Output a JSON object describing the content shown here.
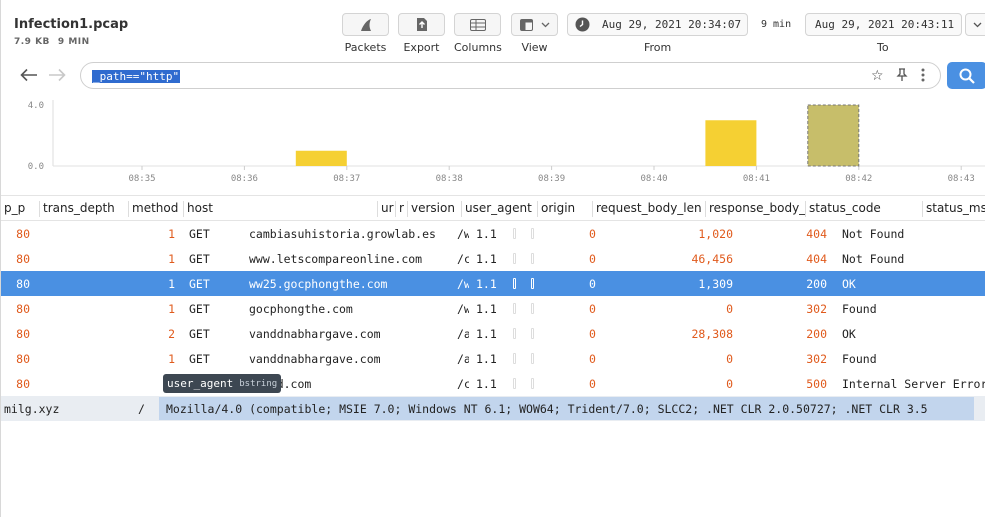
{
  "file": {
    "name": "Infection1.pcap",
    "size": "7.9 KB",
    "duration": "9 MIN"
  },
  "toolbar": {
    "packets": "Packets",
    "export": "Export",
    "columns": "Columns",
    "view": "View",
    "from_value": "Aug 29, 2021 20:34:07",
    "from_label": "From",
    "span": "9 min",
    "to_value": "Aug 29, 2021 20:43:11",
    "to_label": "To"
  },
  "search": {
    "query": "_path==\"http\""
  },
  "histogram": {
    "y_ticks": [
      "4.0",
      "0.0"
    ],
    "x_ticks": [
      "08:35",
      "08:36",
      "08:37",
      "08:38",
      "08:39",
      "08:40",
      "08:41",
      "08:42",
      "08:43"
    ],
    "bars": [
      {
        "minute": "08:37",
        "count": 1
      },
      {
        "minute": "08:41",
        "count": 3
      },
      {
        "minute": "08:42",
        "count": 4,
        "hover": true
      }
    ],
    "bar_color": "#f5d033",
    "hover_color": "#c7be6a"
  },
  "table": {
    "columns": [
      "p_p",
      "trans_depth",
      "method",
      "host",
      "ur",
      "r",
      "version",
      "user_agent",
      "origin",
      "request_body_len",
      "response_body_len",
      "status_code",
      "status_msg"
    ],
    "rows": [
      {
        "port": "80",
        "depth": "1",
        "method": "GET",
        "host": "cambiasuhistoria.growlab.es",
        "uri": "/w",
        "version": "1.1",
        "origin": "0",
        "req": "1,020",
        "resp": "404",
        "msg": "Not Found"
      },
      {
        "port": "80",
        "depth": "1",
        "method": "GET",
        "host": "www.letscompareonline.com",
        "uri": "/c",
        "version": "1.1",
        "origin": "0",
        "req": "46,456",
        "resp": "404",
        "msg": "Not Found"
      },
      {
        "port": "80",
        "depth": "1",
        "method": "GET",
        "host": "ww25.gocphongthe.com",
        "uri": "/w",
        "version": "1.1",
        "origin": "0",
        "req": "1,309",
        "resp": "200",
        "msg": "OK",
        "selected": true
      },
      {
        "port": "80",
        "depth": "1",
        "method": "GET",
        "host": "gocphongthe.com",
        "uri": "/w",
        "version": "1.1",
        "origin": "0",
        "req": "0",
        "resp": "302",
        "msg": "Found"
      },
      {
        "port": "80",
        "depth": "2",
        "method": "GET",
        "host": "vanddnabhargave.com",
        "uri": "/a",
        "version": "1.1",
        "origin": "0",
        "req": "28,308",
        "resp": "200",
        "msg": "OK"
      },
      {
        "port": "80",
        "depth": "1",
        "method": "GET",
        "host": "vanddnabhargave.com",
        "uri": "/a",
        "version": "1.1",
        "origin": "0",
        "req": "0",
        "resp": "302",
        "msg": "Found"
      },
      {
        "port": "80",
        "depth": "",
        "method": "",
        "host": "vrind.com",
        "uri": "/c",
        "version": "1.1",
        "origin": "0",
        "req": "0",
        "resp": "500",
        "msg": "Internal Server Error"
      }
    ]
  },
  "tooltip": {
    "name": "user_agent",
    "type": "bstring"
  },
  "detail": {
    "host": "milg.xyz",
    "uri": "/",
    "user_agent": "Mozilla/4.0 (compatible; MSIE 7.0; Windows NT 6.1; WOW64; Trident/7.0; SLCC2; .NET CLR 2.0.50727; .NET CLR 3.5"
  }
}
